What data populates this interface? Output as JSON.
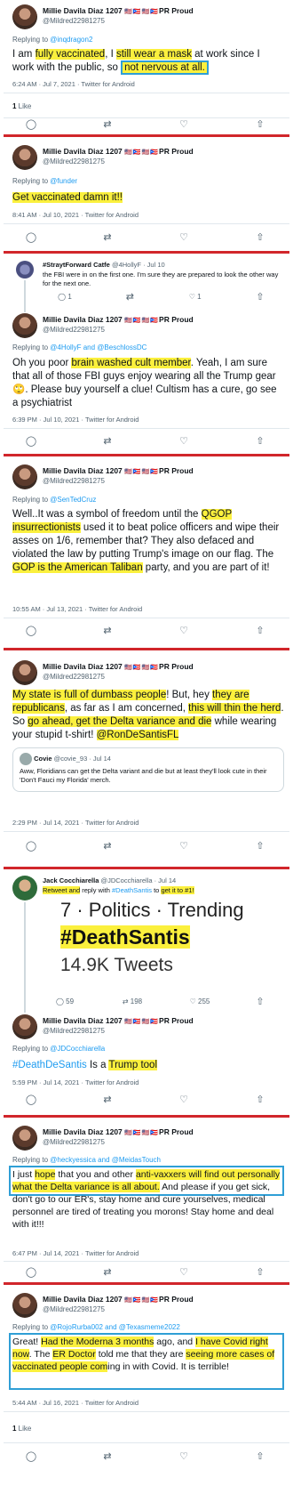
{
  "user": {
    "name": "Millie Davila Diaz 1207",
    "flags": "🇺🇸🇵🇷🇺🇸🇵🇷",
    "suffix": "PR Proud",
    "handle": "@Mildred22981275"
  },
  "t1": {
    "reply_prefix": "Replying to ",
    "reply_to": "@inqdragon2",
    "parts": [
      "I am ",
      "fully vaccinated",
      ", I ",
      "still wear a mask",
      " at work since I work with the public, so ",
      "not nervous at all."
    ],
    "meta": "6:24 AM · Jul 7, 2021 · Twitter for Android",
    "likes_count": "1",
    "likes_label": " Like"
  },
  "t2": {
    "reply_prefix": "Replying to ",
    "reply_to": "@funder",
    "text": "Get vaccinated damn it!!",
    "meta": "8:41 AM · Jul 10, 2021 · Twitter for Android"
  },
  "t3a": {
    "name": "#StraytForward Catfe",
    "handle": "@4HollyF · Jul 10",
    "text": "the FBI were in on the first one. I'm sure they are prepared to look the other way for the next one.",
    "replies": "1",
    "likes": "1"
  },
  "t3": {
    "reply_prefix": "Replying to ",
    "reply_to": "@4HollyF and @BeschlossDC",
    "parts": [
      "Oh you poor ",
      "brain washed cult member",
      ". Yeah, I am sure that all of those FBI guys enjoy wearing all the Trump gear 🙄. Please buy yourself a clue! Cultism has a cure, go see a psychiatrist"
    ],
    "meta": "6:39 PM · Jul 10, 2021 · Twitter for Android"
  },
  "t4": {
    "reply_prefix": "Replying to ",
    "reply_to": "@SenTedCruz",
    "parts": [
      "Well..It was a symbol of freedom until the ",
      "QGOP insurrectionists",
      " used it to beat police officers and wipe their asses on 1/6, remember that? They also defaced and violated the law by putting Trump's image on our flag. The ",
      "GOP is the American Taliban",
      " party, and you are part of it!"
    ],
    "meta": "10:55 AM · Jul 13, 2021 · Twitter for Android"
  },
  "t5": {
    "parts": [
      "My state is full of dumbass people",
      "! But, hey ",
      "they are republicans",
      ", as far as I am concerned, ",
      "this will thin the herd",
      ". So ",
      "go ahead, get the Delta variance and die",
      " while wearing your stupid t-shirt! ",
      "@RonDeSantisFL"
    ],
    "quote_name": "Covie",
    "quote_handle": "@covie_93 · Jul 14",
    "quote_text": "Aww, Floridians can get the Delta variant and die but at least they'll look cute in their 'Don't Fauci my Florida' merch.",
    "meta": "2:29 PM · Jul 14, 2021 · Twitter for Android"
  },
  "t6a": {
    "name": "Jack Cocchiarella",
    "handle": "@JDCocchiarella · Jul 14",
    "text_parts": [
      "Retweet and",
      " reply with ",
      "#DeathSantis",
      " to ",
      "get it to #1!"
    ],
    "trend_line1": "7 · Politics · Trending",
    "trend_line2": "#DeathSantis",
    "trend_line3": "14.9K Tweets",
    "replies": "59",
    "retweets": "198",
    "likes": "255"
  },
  "t6": {
    "reply_prefix": "Replying to ",
    "reply_to": "@JDCocchiarella",
    "parts": [
      "#DeathDeSantis",
      " Is a ",
      "Trump tool"
    ],
    "meta": "5:59 PM · Jul 14, 2021 · Twitter for Android"
  },
  "t7": {
    "reply_prefix": "Replying to ",
    "reply_to": "@heckyessica and @MeidasTouch",
    "parts": [
      "I just ",
      "hope",
      " that you and other ",
      "anti-vaxxers will find out personally what the Delta variance is all about.",
      " And please if you get sick, don't go to our ER's, stay home and cure yourselves, medical personnel are tired of treating you morons! Stay home and deal with it!!!"
    ],
    "meta": "6:47 PM · Jul 14, 2021 · Twitter for Android"
  },
  "t8": {
    "reply_prefix": "Replying to ",
    "reply_to": "@RojoRurba002 and @Texasmeme2022",
    "parts": [
      "Great! ",
      "Had the Moderna 3 months",
      " ago, and ",
      "I have Covid right now",
      ". The ",
      "ER Doctor",
      " told me that they are ",
      "seeing more cases of vaccinated people com",
      "ing in with Covid. It is terrible!"
    ],
    "meta": "5:44 AM · Jul 16, 2021 · Twitter for Android",
    "likes_count": "1",
    "likes_label": " Like"
  },
  "icons": {
    "reply": "reply-icon",
    "retweet": "retweet-icon",
    "like": "heart-icon",
    "share": "share-icon"
  },
  "colors": {
    "highlight": "#fbf03d",
    "separator": "#d1262b",
    "box": "#2f9fd6",
    "link": "#1d9bf0"
  }
}
